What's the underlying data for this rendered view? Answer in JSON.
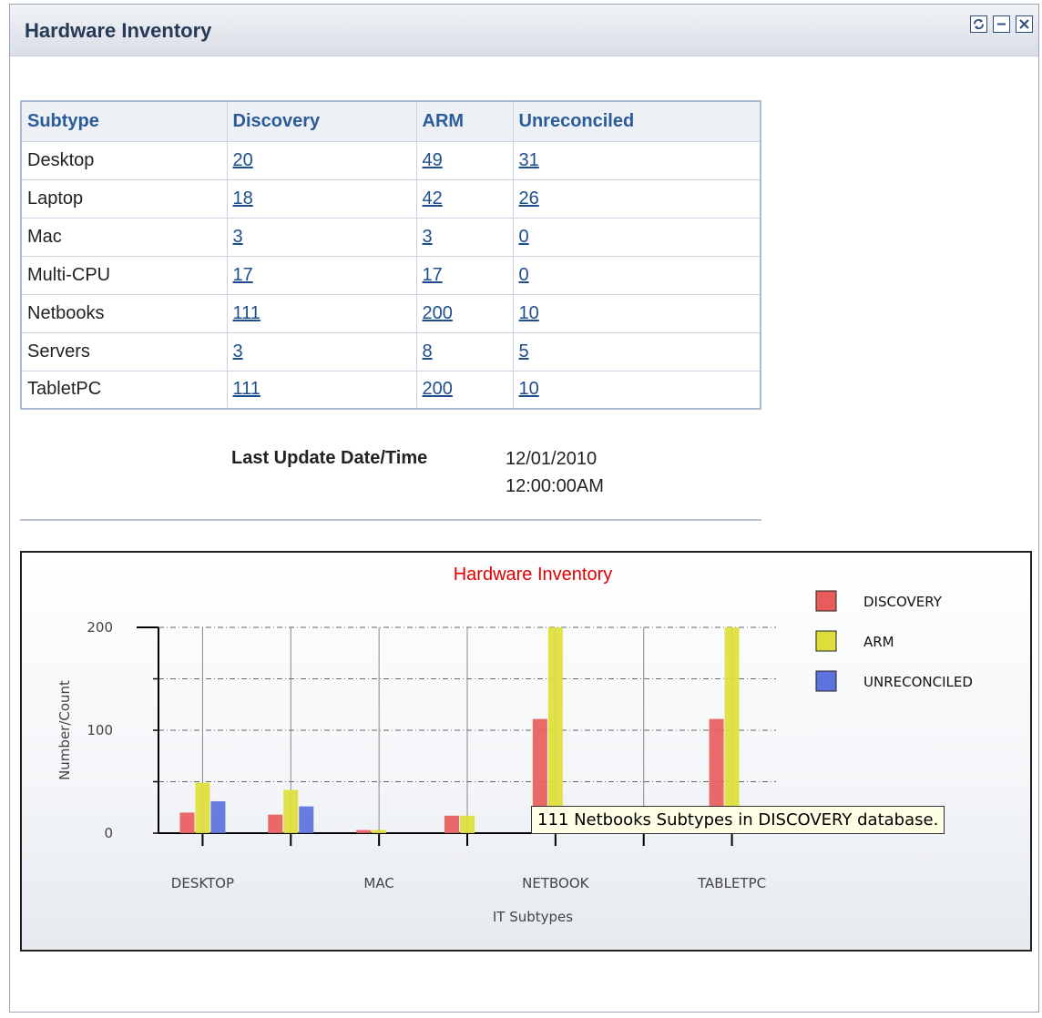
{
  "pagelet": {
    "title": "Hardware Inventory",
    "buttons": [
      {
        "name": "refresh",
        "icon": "refresh-icon"
      },
      {
        "name": "minimize",
        "icon": "minimize-icon"
      },
      {
        "name": "close",
        "icon": "close-icon"
      }
    ]
  },
  "table": {
    "headers": [
      "Subtype",
      "Discovery",
      "ARM",
      "Unreconciled"
    ],
    "rows": [
      {
        "subtype": "Desktop",
        "discovery": "20",
        "arm": "49",
        "unreconciled": "31"
      },
      {
        "subtype": "Laptop",
        "discovery": "18",
        "arm": "42",
        "unreconciled": "26"
      },
      {
        "subtype": "Mac",
        "discovery": "3",
        "arm": "3",
        "unreconciled": "0"
      },
      {
        "subtype": "Multi-CPU",
        "discovery": "17",
        "arm": "17",
        "unreconciled": "0"
      },
      {
        "subtype": "Netbooks",
        "discovery": "111",
        "arm": "200",
        "unreconciled": "10"
      },
      {
        "subtype": "Servers",
        "discovery": "3",
        "arm": "8",
        "unreconciled": "5"
      },
      {
        "subtype": "TabletPC",
        "discovery": "111",
        "arm": "200",
        "unreconciled": "10"
      }
    ]
  },
  "last_update": {
    "label": "Last Update Date/Time",
    "date": "12/01/2010",
    "time": "12:00:00AM"
  },
  "tooltip": {
    "text": "111 Netbooks Subtypes in DISCOVERY database."
  },
  "colors": {
    "discovery": "#e85c5c",
    "arm": "#dede3a",
    "unreconciled": "#5c72dd",
    "title_red": "#e00000",
    "link": "#1f4e8c",
    "header_text": "#2b5c98"
  },
  "chart_data": {
    "type": "bar",
    "title": "Hardware Inventory",
    "xlabel": "IT Subtypes",
    "ylabel": "Number/Count",
    "ylim": [
      0,
      200
    ],
    "yticks": [
      0,
      100,
      200
    ],
    "categories": [
      "DESKTOP",
      "LAPTOP",
      "MAC",
      "MULTI-CPU",
      "NETBOOK",
      "SERVERS",
      "TABLETPC"
    ],
    "category_labels_shown": [
      "DESKTOP",
      "",
      "MAC",
      "",
      "NETBOOK",
      "",
      "TABLETPC"
    ],
    "series": [
      {
        "name": "DISCOVERY",
        "values": [
          20,
          18,
          3,
          17,
          111,
          3,
          111
        ]
      },
      {
        "name": "ARM",
        "values": [
          49,
          42,
          3,
          17,
          200,
          8,
          200
        ]
      },
      {
        "name": "UNRECONCILED",
        "values": [
          31,
          26,
          0,
          0,
          10,
          5,
          10
        ]
      }
    ],
    "grid": true,
    "legend": "right"
  }
}
